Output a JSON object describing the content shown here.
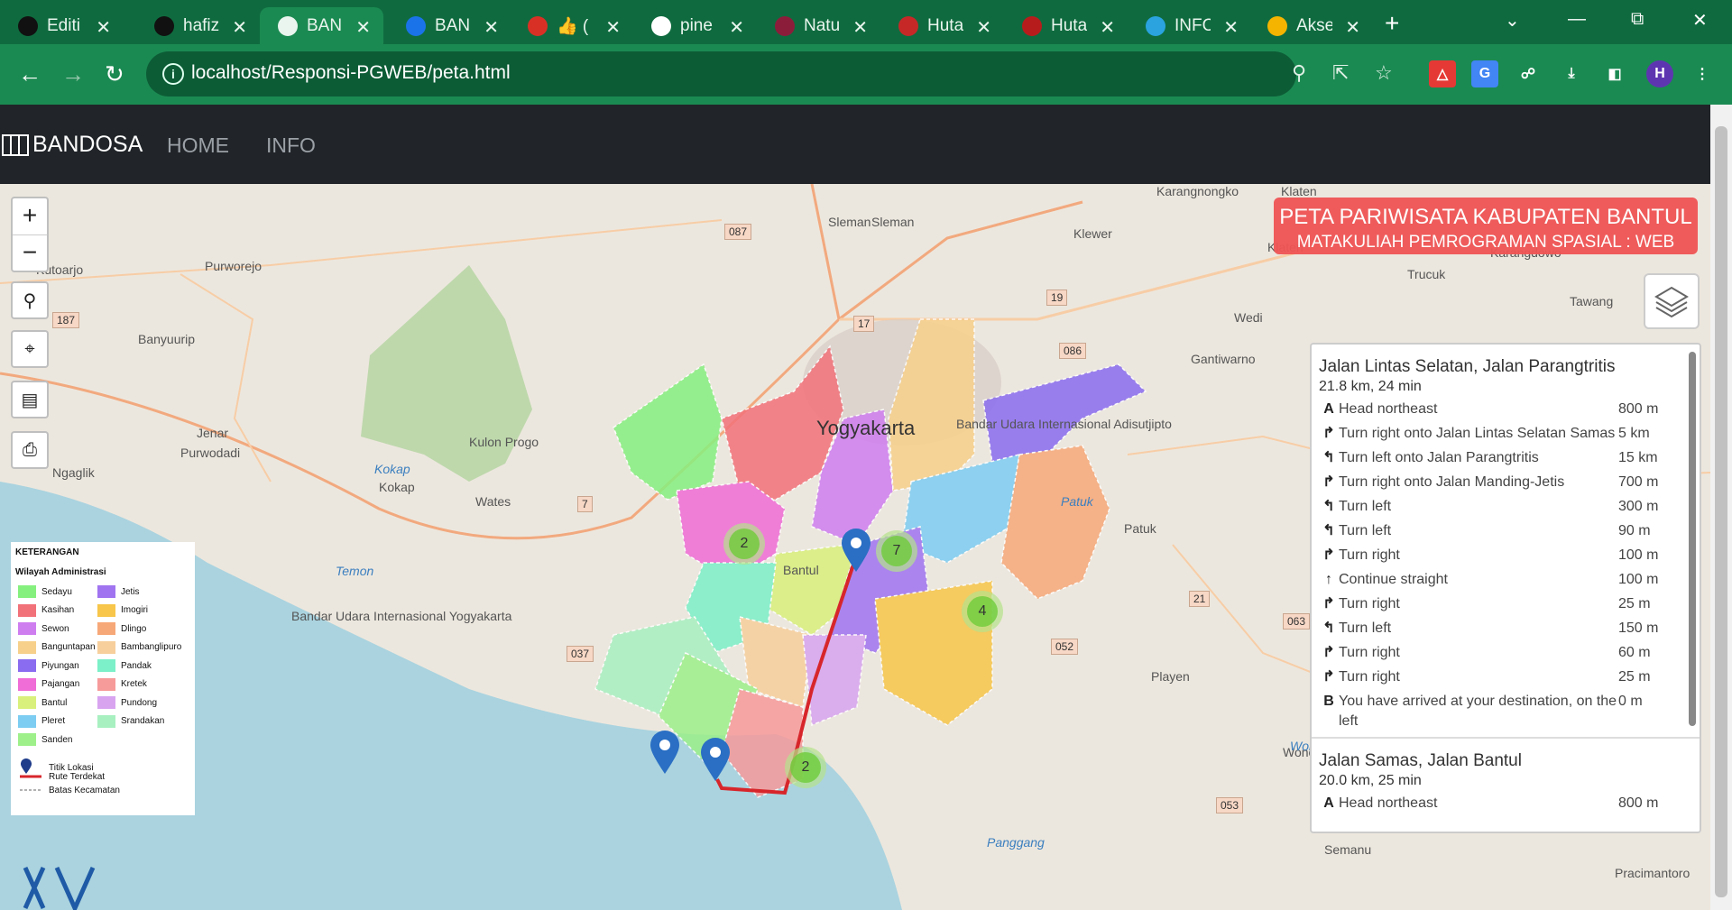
{
  "browser": {
    "tabs": [
      {
        "title": "Editi",
        "icon": "github-icon",
        "color": "#111111"
      },
      {
        "title": "hafiz",
        "icon": "github-icon",
        "color": "#111111"
      },
      {
        "title": "BAN",
        "icon": "globe-icon",
        "color": "#e9f5ee",
        "active": true
      },
      {
        "title": "BAN",
        "icon": "wave-icon",
        "color": "#1a73e8"
      },
      {
        "title": "👍 (",
        "icon": "red-arrow-icon",
        "color": "#d93025"
      },
      {
        "title": "pine",
        "icon": "google-icon",
        "color": "#ffffff"
      },
      {
        "title": "Natu",
        "icon": "nature-icon",
        "color": "#8b1d3b"
      },
      {
        "title": "Huta",
        "icon": "m-icon",
        "color": "#c62828"
      },
      {
        "title": "Huta",
        "icon": "emblem-icon",
        "color": "#b71c1c"
      },
      {
        "title": "INFO",
        "icon": "telegram-icon",
        "color": "#2aa3df"
      },
      {
        "title": "Akse",
        "icon": "slides-icon",
        "color": "#f4b400"
      }
    ],
    "url": "localhost/Responsi-PGWEB/peta.html",
    "profile_initial": "H"
  },
  "navbar": {
    "brand": "BANDOSA",
    "links": [
      "HOME",
      "INFO"
    ]
  },
  "map": {
    "title": "PETA PARIWISATA KABUPATEN BANTUL",
    "subtitle": "MATAKULIAH PEMROGRAMAN SPASIAL : WEB",
    "zoom_in": "+",
    "zoom_out": "−",
    "labels": [
      "Kutoarjo",
      "Purworejo",
      "Banyuurip",
      "Jenar",
      "Purwodadi",
      "Ngaglik",
      "Kulon Progo",
      "Kokap",
      "Kokap",
      "Wates",
      "Temon",
      "Bandar Udara Internasional Yogyakarta",
      "Sleman",
      "Sleman",
      "Klewer",
      "Karangnongko",
      "Klaten",
      "Klaten",
      "Karangdowo",
      "Trucuk",
      "Wedi",
      "Tawang",
      "Gantiwarno",
      "Yogyakarta",
      "Bandar Udara Internasional Adisutjipto",
      "Patuk",
      "Patuk",
      "Bantul",
      "Playen",
      "Wonosari",
      "Wonosari",
      "Panggang",
      "Semanu",
      "Pracimantoro"
    ],
    "road_numbers": [
      "087",
      "19",
      "17",
      "187",
      "086",
      "7",
      "21",
      "037",
      "052",
      "063",
      "053"
    ],
    "clusters": [
      "2",
      "7",
      "4",
      "2"
    ]
  },
  "routes": [
    {
      "name": "Jalan Lintas Selatan, Jalan Parangtritis",
      "summary": "21.8 km, 24 min",
      "steps": [
        {
          "icon": "A",
          "text": "Head northeast",
          "dist": "800 m"
        },
        {
          "icon": "↱",
          "text": "Turn right onto Jalan Lintas Selatan Samas",
          "dist": "5 km"
        },
        {
          "icon": "↰",
          "text": "Turn left onto Jalan Parangtritis",
          "dist": "15 km"
        },
        {
          "icon": "↱",
          "text": "Turn right onto Jalan Manding-Jetis",
          "dist": "700 m"
        },
        {
          "icon": "↰",
          "text": "Turn left",
          "dist": "300 m"
        },
        {
          "icon": "↰",
          "text": "Turn left",
          "dist": "90 m"
        },
        {
          "icon": "↱",
          "text": "Turn right",
          "dist": "100 m"
        },
        {
          "icon": "↑",
          "text": "Continue straight",
          "dist": "100 m"
        },
        {
          "icon": "↱",
          "text": "Turn right",
          "dist": "25 m"
        },
        {
          "icon": "↰",
          "text": "Turn left",
          "dist": "150 m"
        },
        {
          "icon": "↱",
          "text": "Turn right",
          "dist": "60 m"
        },
        {
          "icon": "↱",
          "text": "Turn right",
          "dist": "25 m"
        },
        {
          "icon": "B",
          "text": "You have arrived at your destination, on the left",
          "dist": "0 m"
        }
      ]
    },
    {
      "name": "Jalan Samas, Jalan Bantul",
      "summary": "20.0 km, 25 min",
      "steps": [
        {
          "icon": "A",
          "text": "Head northeast",
          "dist": "800 m"
        }
      ]
    }
  ],
  "legend": {
    "title": "KETERANGAN",
    "subtitle": "Wilayah Administrasi",
    "items": [
      {
        "label": "Sedayu",
        "color": "#86f07f"
      },
      {
        "label": "Kasihan",
        "color": "#f2727a"
      },
      {
        "label": "Sewon",
        "color": "#cf7ef0"
      },
      {
        "label": "Banguntapan",
        "color": "#f7d08b"
      },
      {
        "label": "Piyungan",
        "color": "#8a6cf0"
      },
      {
        "label": "Pajangan",
        "color": "#f06cd6"
      },
      {
        "label": "Bantul",
        "color": "#d9f07c"
      },
      {
        "label": "Pleret",
        "color": "#7dcdf2"
      },
      {
        "label": "Sanden",
        "color": "#9df08a"
      },
      {
        "label": "Jetis",
        "color": "#a074f0"
      },
      {
        "label": "Imogiri",
        "color": "#f7c64a"
      },
      {
        "label": "Dlingo",
        "color": "#f7a878"
      },
      {
        "label": "Bambanglipuro",
        "color": "#f7cf9c"
      },
      {
        "label": "Pandak",
        "color": "#7cf0c8"
      },
      {
        "label": "Kretek",
        "color": "#f79a9a"
      },
      {
        "label": "Pundong",
        "color": "#d8a4f0"
      },
      {
        "label": "Srandakan",
        "color": "#a8f0c0"
      }
    ],
    "symbols": [
      {
        "label": "Titik Lokasi"
      },
      {
        "label": "Rute Terdekat"
      },
      {
        "label": "Batas Kecamatan"
      }
    ]
  }
}
